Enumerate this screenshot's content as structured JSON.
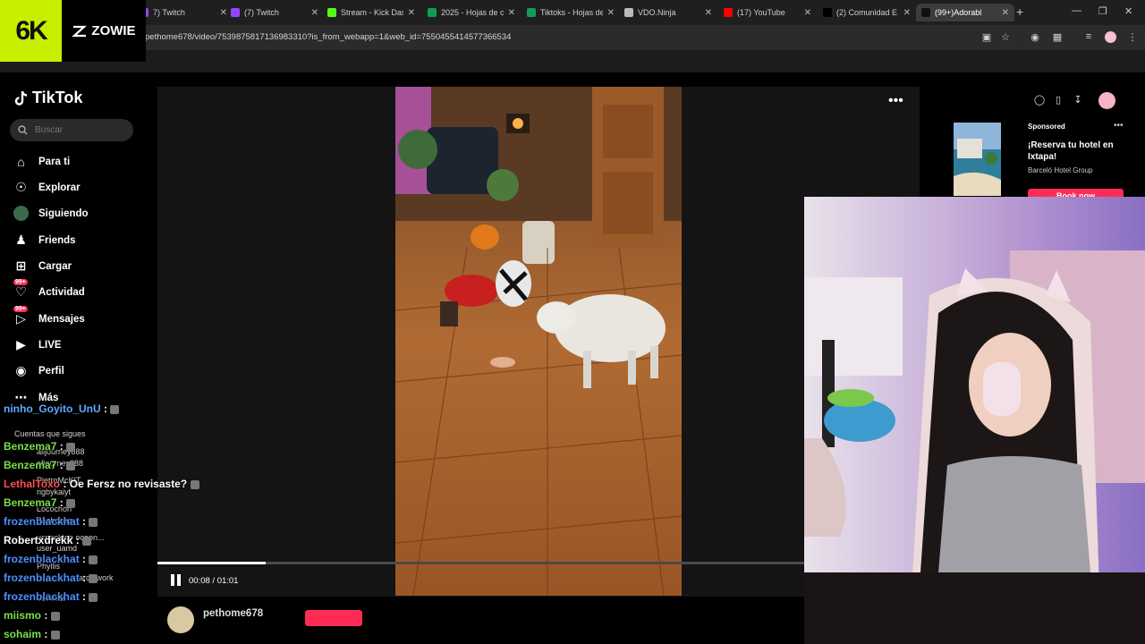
{
  "browser": {
    "tabs": [
      {
        "label": "7) Twitch",
        "color": "#9146ff"
      },
      {
        "label": "(7) Twitch",
        "color": "#9146ff"
      },
      {
        "label": "Stream - Kick Das",
        "color": "#53fc18"
      },
      {
        "label": "2025 - Hojas de c",
        "color": "#0f9d58"
      },
      {
        "label": "Tiktoks - Hojas de",
        "color": "#0f9d58"
      },
      {
        "label": "VDO.Ninja",
        "color": "#bbbbbb"
      },
      {
        "label": "(17) YouTube",
        "color": "#ff0000"
      },
      {
        "label": "(2) Comunidad E",
        "color": "#000000"
      },
      {
        "label": "(99+)Adorabl",
        "color": "#111111"
      }
    ],
    "url": "pethome678/video/7539875817136983310?is_from_webapp=1&web_id=7550455414577366534"
  },
  "overlay": {
    "logo_left": "6K",
    "logo_right": "ZOWIE",
    "logo_color": "#c6f000"
  },
  "sidebar": {
    "brand": "TikTok",
    "search_placeholder": "Buscar",
    "items": [
      {
        "label": "Para ti",
        "icon": "home-icon"
      },
      {
        "label": "Explorar",
        "icon": "compass-icon"
      },
      {
        "label": "Siguiendo",
        "icon": "following-avatar-icon"
      },
      {
        "label": "Friends",
        "icon": "friends-icon"
      },
      {
        "label": "Cargar",
        "icon": "upload-icon"
      },
      {
        "label": "Actividad",
        "icon": "activity-icon",
        "badge": "99+"
      },
      {
        "label": "Mensajes",
        "icon": "messages-icon",
        "badge": "99+"
      },
      {
        "label": "LIVE",
        "icon": "live-icon"
      },
      {
        "label": "Perfil",
        "icon": "profile-icon"
      },
      {
        "label": "Más",
        "icon": "more-icon"
      }
    ],
    "following_header": "Cuentas que sigues",
    "following": [
      "alljourney888",
      "ofjourney888",
      "PietroMcKIT",
      "rigbykaiyt",
      "Locochon",
      "Bacbcbaa",
      "ucpacktoe ocoon...",
      "user_uamd",
      "Phyllis",
      "arctywork",
      "Ver más"
    ]
  },
  "video": {
    "time": "00:08 / 01:01",
    "progress": 0.168,
    "author": "pethome678"
  },
  "ad": {
    "sponsored": "Sponsored",
    "title": "¡Reserva tu hotel en Ixtapa!",
    "brand": "Barceló Hotel Group",
    "cta": "Book now"
  },
  "chat": [
    {
      "user": "ninho_Goyito_UnU",
      "color": "#5fa8ff",
      "msg": ""
    },
    {
      "user": "Benzema7",
      "color": "#7adf4a",
      "msg": ""
    },
    {
      "user": "Benzema7",
      "color": "#7adf4a",
      "msg": ""
    },
    {
      "user": "LethalToxo",
      "color": "#ff4d4d",
      "msg": "Oe Fersz no revisaste?"
    },
    {
      "user": "Benzema7",
      "color": "#7adf4a",
      "msg": ""
    },
    {
      "user": "frozenblackhat",
      "color": "#4d8fff",
      "msg": ""
    },
    {
      "user": "Robertxdrekk",
      "color": "#ffffff",
      "msg": ""
    },
    {
      "user": "frozenblackhat",
      "color": "#4d8fff",
      "msg": ""
    },
    {
      "user": "frozenblackhat",
      "color": "#4d8fff",
      "msg": ""
    },
    {
      "user": "frozenblackhat",
      "color": "#4d8fff",
      "msg": ""
    },
    {
      "user": "miismo",
      "color": "#7adf4a",
      "msg": ""
    },
    {
      "user": "sohaim",
      "color": "#7adf4a",
      "msg": ""
    }
  ]
}
